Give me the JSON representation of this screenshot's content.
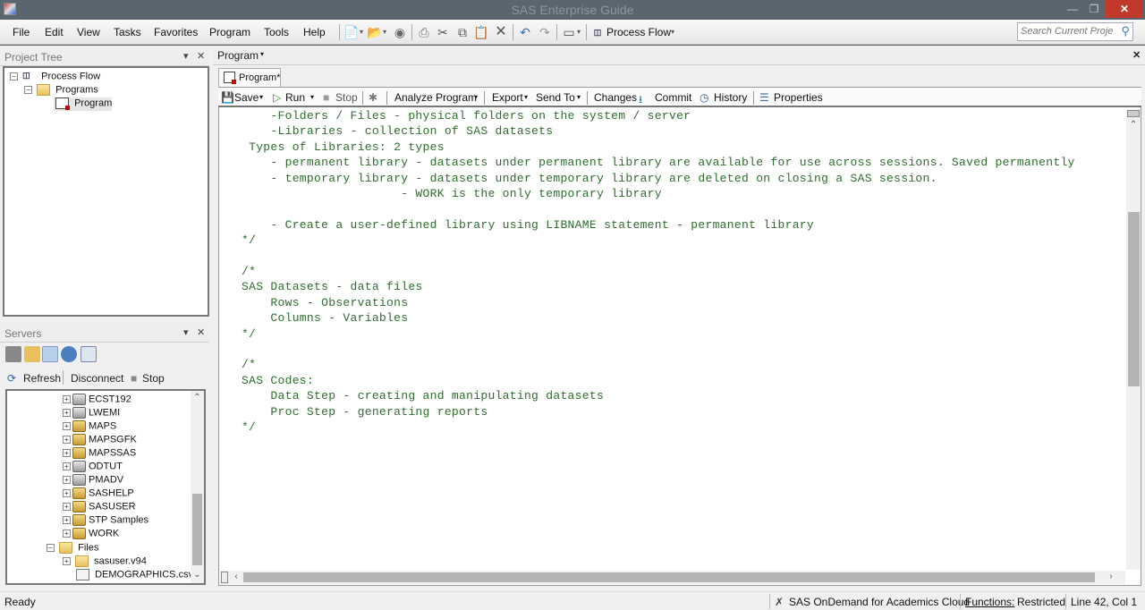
{
  "window": {
    "title": "SAS Enterprise Guide",
    "minimize_icon": "minimize-icon",
    "maximize_icon": "restore-icon",
    "close_icon": "close-icon"
  },
  "menubar": {
    "items": [
      "File",
      "Edit",
      "View",
      "Tasks",
      "Favorites",
      "Program",
      "Tools",
      "Help"
    ],
    "process_flow_label": "Process Flow",
    "search_placeholder": "Search Current Project"
  },
  "project_tree": {
    "title": "Project Tree",
    "nodes": [
      {
        "label": "Process Flow",
        "icon": "process-flow-icon"
      },
      {
        "label": "Programs",
        "icon": "folder-icon"
      },
      {
        "label": "Program",
        "icon": "program-icon"
      }
    ]
  },
  "servers": {
    "title": "Servers",
    "actions": {
      "refresh": "Refresh",
      "disconnect": "Disconnect",
      "stop": "Stop"
    },
    "libraries": [
      {
        "label": "ECST192",
        "icon": "library-gray-icon"
      },
      {
        "label": "LWEMI",
        "icon": "library-gray-icon"
      },
      {
        "label": "MAPS",
        "icon": "library-gold-icon"
      },
      {
        "label": "MAPSGFK",
        "icon": "library-gold-icon"
      },
      {
        "label": "MAPSSAS",
        "icon": "library-gold-icon"
      },
      {
        "label": "ODTUT",
        "icon": "library-gray-icon"
      },
      {
        "label": "PMADV",
        "icon": "library-gray-icon"
      },
      {
        "label": "SASHELP",
        "icon": "library-gold-icon"
      },
      {
        "label": "SASUSER",
        "icon": "library-gold-icon"
      },
      {
        "label": "STP Samples",
        "icon": "library-gold-icon"
      },
      {
        "label": "WORK",
        "icon": "library-gold-icon"
      }
    ],
    "files_label": "Files",
    "files": [
      {
        "label": "sasuser.v94",
        "icon": "folder-icon"
      },
      {
        "label": "DEMOGRAPHICS.csv",
        "icon": "csv-file-icon"
      }
    ]
  },
  "document": {
    "header_label": "Program",
    "tab_label": "Program*",
    "toolbar": {
      "save": "Save",
      "run": "Run",
      "stop": "Stop",
      "analyze": "Analyze Program",
      "export": "Export",
      "send_to": "Send To",
      "changes": "Changes",
      "commit": "Commit",
      "history": "History",
      "properties": "Properties"
    },
    "code_lines": [
      "    -Folders / Files - physical folders on the system / server",
      "    -Libraries - collection of SAS datasets",
      " Types of Libraries: 2 types",
      "    - permanent library - datasets under permanent library are available for use across sessions. Saved permanently",
      "    - temporary library - datasets under temporary library are deleted on closing a SAS session.",
      "                      - WORK is the only temporary library",
      "",
      "    - Create a user-defined library using LIBNAME statement - permanent library",
      "*/",
      "",
      "/*",
      "SAS Datasets - data files",
      "    Rows - Observations",
      "    Columns - Variables",
      "*/",
      "",
      "/*",
      "SAS Codes:",
      "    Data Step - creating and manipulating datasets",
      "    Proc Step - generating reports",
      "*/"
    ]
  },
  "statusbar": {
    "status": "Ready",
    "server": "SAS OnDemand for Academics Cloud",
    "functions_label": "Functions:",
    "functions_value": "Restricted",
    "cursor_position": "Line 42, Col 1"
  }
}
